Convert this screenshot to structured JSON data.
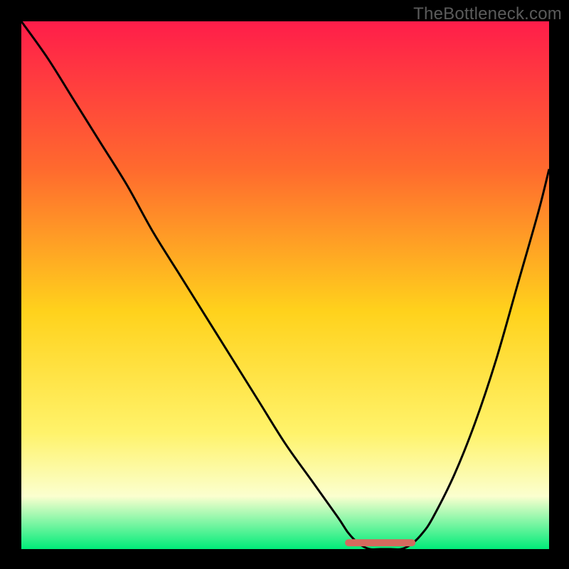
{
  "watermark": "TheBottleneck.com",
  "colors": {
    "page_bg": "#000000",
    "gradient_top": "#ff1d4a",
    "gradient_mid_upper": "#ff6a2e",
    "gradient_mid": "#ffd21c",
    "gradient_mid_lower": "#fff36b",
    "gradient_lower": "#fbffcf",
    "gradient_bottom": "#00ec79",
    "curve": "#000000",
    "marker": "#d46a5e"
  },
  "chart_data": {
    "type": "line",
    "title": "",
    "xlabel": "",
    "ylabel": "",
    "xlim": [
      0,
      100
    ],
    "ylim": [
      0,
      100
    ],
    "series": [
      {
        "name": "bottleneck-curve",
        "x": [
          0,
          5,
          10,
          15,
          20,
          25,
          30,
          35,
          40,
          45,
          50,
          55,
          60,
          62,
          64,
          66,
          68,
          70,
          72,
          74,
          76,
          78,
          82,
          86,
          90,
          94,
          98,
          100
        ],
        "y": [
          100,
          93,
          85,
          77,
          69,
          60,
          52,
          44,
          36,
          28,
          20,
          13,
          6,
          3,
          1,
          0,
          0,
          0,
          0,
          1,
          3,
          6,
          14,
          24,
          36,
          50,
          64,
          72
        ]
      }
    ],
    "annotations": [
      {
        "name": "valley-marker",
        "type": "segment",
        "x0": 62,
        "x1": 74,
        "y": 1.2,
        "stroke": "#d46a5e",
        "stroke_width_px": 10,
        "linecap": "round"
      }
    ],
    "background": {
      "type": "vertical-gradient",
      "stops": [
        {
          "offset": 0.0,
          "color": "#ff1d4a"
        },
        {
          "offset": 0.28,
          "color": "#ff6a2e"
        },
        {
          "offset": 0.55,
          "color": "#ffd21c"
        },
        {
          "offset": 0.78,
          "color": "#fff36b"
        },
        {
          "offset": 0.9,
          "color": "#fbffcf"
        },
        {
          "offset": 1.0,
          "color": "#00ec79"
        }
      ]
    }
  }
}
